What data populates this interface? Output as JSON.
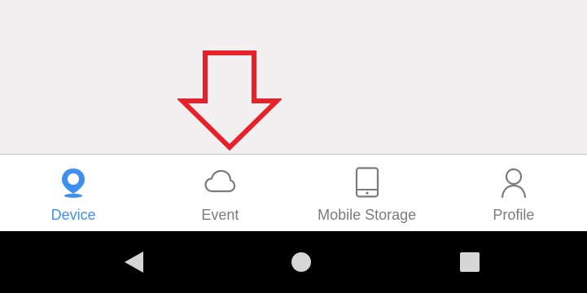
{
  "tabs": [
    {
      "label": "Device",
      "icon": "location-pin-icon",
      "active": true
    },
    {
      "label": "Event",
      "icon": "cloud-icon",
      "active": false
    },
    {
      "label": "Mobile Storage",
      "icon": "tablet-icon",
      "active": false
    },
    {
      "label": "Profile",
      "icon": "person-icon",
      "active": false
    }
  ],
  "nav": {
    "back": "back-triangle-icon",
    "home": "home-circle-icon",
    "recent": "recents-square-icon"
  },
  "colors": {
    "content_background": "#f2eff1",
    "active_tab": "#3f8ff0",
    "inactive_tab": "#7b7b7b",
    "annotation_arrow": "#e8202a",
    "nav_bar": "#000000",
    "nav_icon": "#d6d6d6"
  }
}
